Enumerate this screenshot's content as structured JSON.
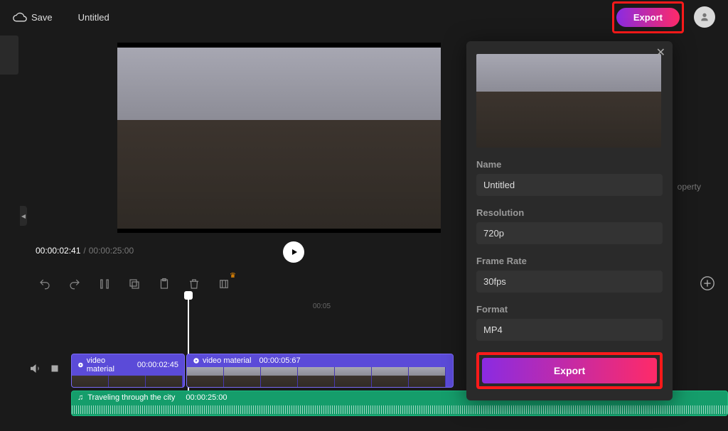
{
  "topbar": {
    "save_label": "Save",
    "project_title": "Untitled",
    "export_label": "Export"
  },
  "preview": {
    "current_time": "00:00:02:41",
    "total_time": "00:00:25:00"
  },
  "timeline": {
    "ticks": [
      "00:05"
    ]
  },
  "clips": {
    "video1": {
      "label": "video material",
      "time": "00:00:02:45"
    },
    "video2": {
      "label": "video material",
      "time": "00:00:05:67"
    },
    "audio": {
      "label": "Traveling through the city",
      "time": "00:00:25:00"
    }
  },
  "export_panel": {
    "name_label": "Name",
    "name_value": "Untitled",
    "resolution_label": "Resolution",
    "resolution_value": "720p",
    "framerate_label": "Frame Rate",
    "framerate_value": "30fps",
    "format_label": "Format",
    "format_value": "MP4",
    "export_button": "Export"
  },
  "misc": {
    "property_text": "operty"
  }
}
